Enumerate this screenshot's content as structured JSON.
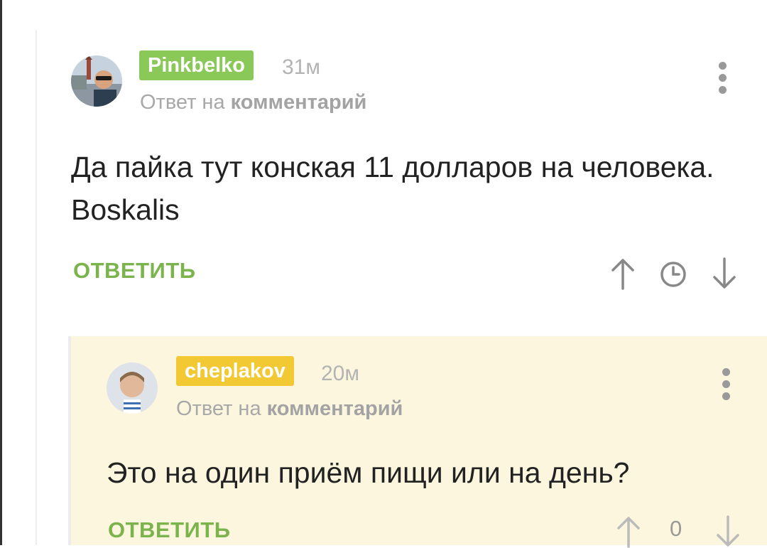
{
  "comments": [
    {
      "username": "Pinkbelko",
      "time": "31м",
      "reply_prefix": "Ответ на",
      "reply_link": "комментарий",
      "body": "Да пайка тут конская 11 долларов на человека. Boskalis",
      "reply_label": "ОТВЕТИТЬ",
      "icons": [
        "arrow-up-icon",
        "clock-icon",
        "arrow-down-icon"
      ],
      "badge_color": "#8ac858"
    },
    {
      "username": "cheplakov",
      "time": "20м",
      "reply_prefix": "Ответ на",
      "reply_link": "комментарий",
      "body": "Это на один приём пищи или на день?",
      "reply_label": "ОТВЕТИТЬ",
      "rating": "0",
      "icons": [
        "arrow-up-icon",
        "arrow-down-icon"
      ],
      "badge_color": "#f2c833"
    }
  ],
  "colors": {
    "accent_green": "#7bb34c",
    "reply_background": "#fdf6df",
    "text": "#222222",
    "muted": "#a8a8a8"
  }
}
